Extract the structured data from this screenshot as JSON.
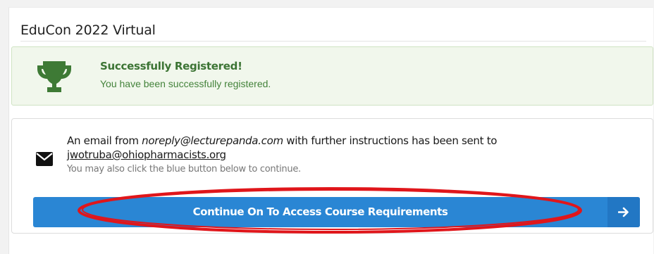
{
  "page": {
    "title": "EduCon 2022 Virtual"
  },
  "alert": {
    "icon": "trophy-icon",
    "heading": "Successfully Registered!",
    "message": "You have been successfully registered.",
    "colors": {
      "background": "#f1f7ec",
      "border": "#cfe3c3",
      "text": "#3c7434",
      "icon": "#3e7a35"
    }
  },
  "email_notice": {
    "icon": "envelope-icon",
    "prefix": "An email from ",
    "sender": "noreply@lecturepanda.com",
    "suffix": " with further instructions has been sent to",
    "address": "jwotruba@ohiopharmacists.org",
    "hint": "You may also click the blue button below to continue."
  },
  "continue_button": {
    "label": "Continue On To Access Course Requirements",
    "icon": "arrow-right-icon",
    "color": "#2a86d4"
  },
  "annotation": {
    "shape": "ellipse",
    "color": "#e0161b"
  }
}
